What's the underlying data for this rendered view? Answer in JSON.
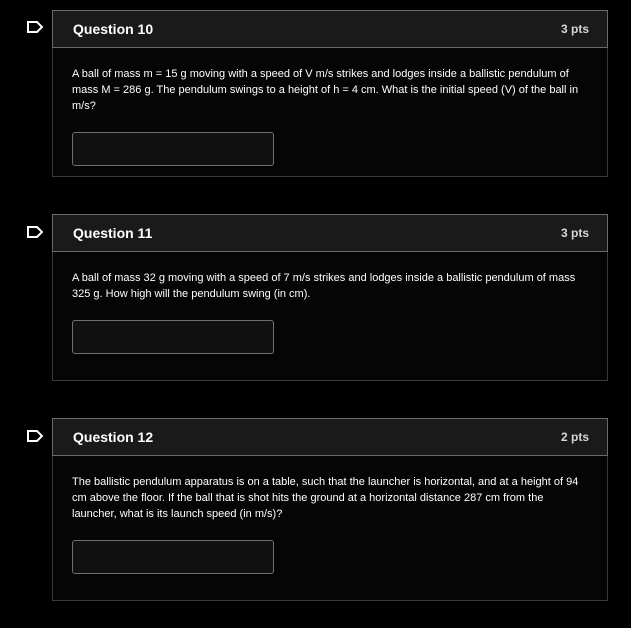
{
  "questions": [
    {
      "title": "Question 10",
      "points": "3 pts",
      "text": "A ball of mass m = 15 g moving with a speed of V m/s strikes and lodges inside a ballistic pendulum of mass M = 286 g. The pendulum swings to a height of h = 4 cm. What is the initial speed (V) of the ball in m/s?",
      "answer_value": ""
    },
    {
      "title": "Question 11",
      "points": "3 pts",
      "text": "A ball of mass 32 g moving with a speed of 7 m/s strikes and lodges inside a ballistic pendulum of mass 325 g. How high will the pendulum swing (in cm).",
      "answer_value": ""
    },
    {
      "title": "Question 12",
      "points": "2 pts",
      "text": "The ballistic pendulum apparatus is on a table, such that the launcher is horizontal, and at a height of 94 cm above the floor. If the ball that is shot hits the ground at a horizontal distance 287 cm from the launcher, what is its launch speed (in m/s)?",
      "answer_value": ""
    }
  ],
  "icons": {
    "flag": "flag-icon"
  },
  "colors": {
    "background": "#000000",
    "header_bg": "#1a1a1a",
    "border": "#6a6a6a",
    "text": "#ffffff"
  }
}
